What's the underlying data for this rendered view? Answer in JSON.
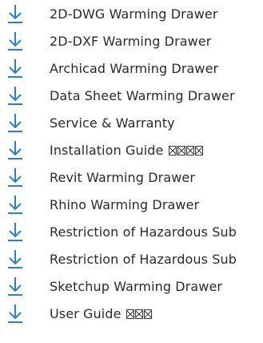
{
  "accent_color": "#2d7fc1",
  "text_color": "#2a2a2a",
  "downloads": [
    {
      "label": "2D-DWG Warming Drawer",
      "icon": "download-icon"
    },
    {
      "label": "2D-DXF Warming Drawer",
      "icon": "download-icon"
    },
    {
      "label": "Archicad Warming Drawer",
      "icon": "download-icon"
    },
    {
      "label": "Data Sheet Warming Drawer",
      "icon": "download-icon"
    },
    {
      "label": "Service & Warranty",
      "icon": "download-icon"
    },
    {
      "label": "Installation Guide ",
      "icon": "download-icon",
      "missing_glyphs": 4
    },
    {
      "label": "Revit Warming Drawer",
      "icon": "download-icon"
    },
    {
      "label": "Rhino Warming Drawer",
      "icon": "download-icon"
    },
    {
      "label": "Restriction of Hazardous Sub",
      "icon": "download-icon"
    },
    {
      "label": "Restriction of Hazardous Sub",
      "icon": "download-icon"
    },
    {
      "label": "Sketchup Warming Drawer",
      "icon": "download-icon"
    },
    {
      "label": "User Guide ",
      "icon": "download-icon",
      "missing_glyphs": 3
    }
  ]
}
